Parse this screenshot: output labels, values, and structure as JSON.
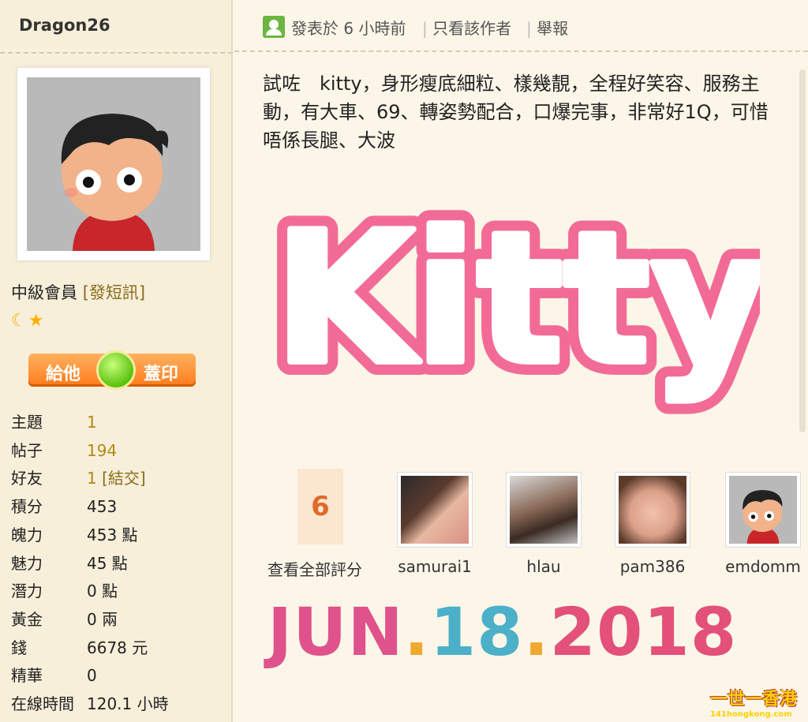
{
  "sidebar": {
    "username": "Dragon26",
    "member_level": "中級會員",
    "pm_link": "[發短訊]",
    "rank_icons": "moon-star",
    "stamp_left": "給他",
    "stamp_right": "蓋印",
    "stats": [
      {
        "label": "主題",
        "value": "1"
      },
      {
        "label": "帖子",
        "value": "194"
      },
      {
        "label": "好友",
        "value": "1",
        "extra": "[結交]"
      },
      {
        "label": "積分",
        "value": "453"
      },
      {
        "label": "魄力",
        "value": "453 點"
      },
      {
        "label": "魅力",
        "value": "45 點"
      },
      {
        "label": "潛力",
        "value": "0 點"
      },
      {
        "label": "黃金",
        "value": "0 兩"
      },
      {
        "label": "錢",
        "value": "6678 元"
      },
      {
        "label": "精華",
        "value": "0"
      },
      {
        "label": "在線時間",
        "value": "120.1 小時"
      }
    ]
  },
  "post": {
    "posted": "發表於 6 小時前",
    "only_author": "只看該作者",
    "report": "舉報",
    "text": "試咗　kitty，身形瘦底細粒、樣幾靚，全程好笑容、服務主動，有大車、69、轉姿勢配合，口爆完事，非常好1Q，可惜唔係長腿、大波",
    "banner_text": "Kitty",
    "banner_color": "#f26b96"
  },
  "rating": {
    "count": "6",
    "view_all": "查看全部評分",
    "raters": [
      {
        "name": "samurai1"
      },
      {
        "name": "hlau"
      },
      {
        "name": "pam386"
      },
      {
        "name": "emdomm"
      }
    ]
  },
  "date": {
    "parts": [
      "JUN",
      ".",
      "18",
      ".",
      "2018"
    ],
    "colors": [
      "#e0528c",
      "#f0a830",
      "#4bb0c8",
      "#f0a830",
      "#e3507a"
    ]
  },
  "watermark": {
    "line1": "一世一香港",
    "line2": "141hongkong.com"
  }
}
